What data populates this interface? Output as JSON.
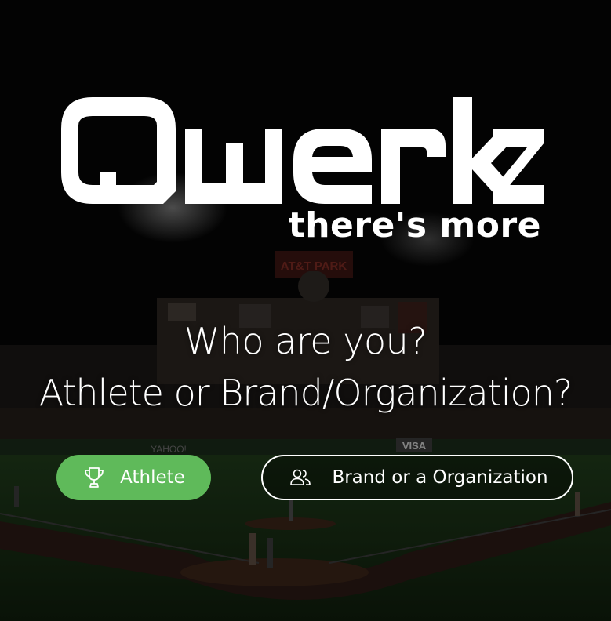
{
  "brand": {
    "logo_text": "Qwerkz",
    "tagline": "there's more"
  },
  "question": {
    "line1": "Who are you?",
    "line2": "Athlete or Brand/Organization?"
  },
  "actions": {
    "athlete": {
      "label": "Athlete",
      "icon": "trophy-icon"
    },
    "brand": {
      "label": "Brand or a Organization",
      "icon": "users-icon"
    }
  },
  "background": {
    "scoreboard_text": "AT&T PARK",
    "sign_visa": "VISA",
    "sign_yahoo": "YAHOO!"
  },
  "colors": {
    "accent": "#5fba5a",
    "text": "#ffffff",
    "overlay": "#000000"
  }
}
